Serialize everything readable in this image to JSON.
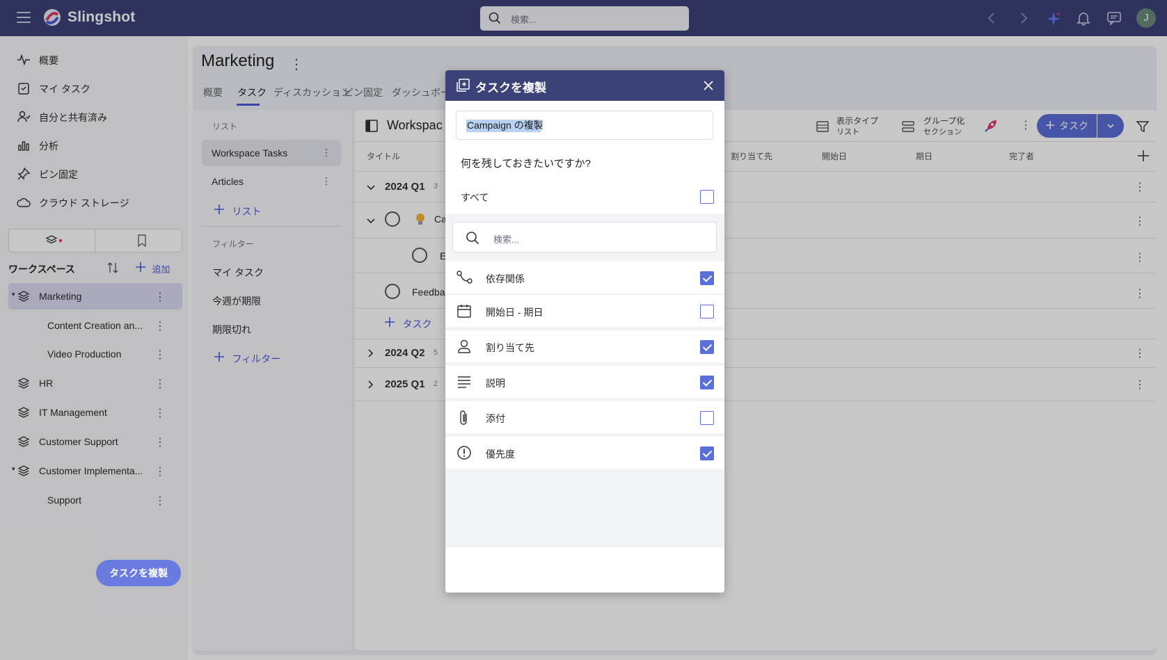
{
  "app": {
    "brand": "Slingshot",
    "search_placeholder": "検索...",
    "avatar_initial": "J"
  },
  "sidebar": {
    "nav": [
      {
        "label": "概要",
        "icon": "activity-icon"
      },
      {
        "label": "マイ タスク",
        "icon": "task-clipboard-icon"
      },
      {
        "label": "自分と共有済み",
        "icon": "shared-user-icon"
      },
      {
        "label": "分析",
        "icon": "bar-chart-icon"
      },
      {
        "label": "ピン固定",
        "icon": "pin-icon"
      },
      {
        "label": "クラウド ストレージ",
        "icon": "cloud-icon"
      }
    ],
    "workspaces_title": "ワークスペース",
    "add_label": "追加",
    "workspaces": [
      {
        "label": "Marketing",
        "selected": true
      },
      {
        "label": "Content Creation an...",
        "child": true
      },
      {
        "label": "Video Production",
        "child": true
      },
      {
        "label": "HR"
      },
      {
        "label": "IT Management"
      },
      {
        "label": "Customer Support"
      },
      {
        "label": "Customer Implementa..."
      },
      {
        "label": "Support",
        "child": true
      }
    ]
  },
  "project": {
    "title": "Marketing",
    "tabs": [
      "概要",
      "タスク",
      "ディスカッション",
      "ピン固定",
      "ダッシュボード"
    ],
    "active_tab": "タスク"
  },
  "lists": {
    "section_label": "リスト",
    "items": [
      "Workspace Tasks",
      "Articles"
    ],
    "add_list": "リスト",
    "filter_label": "フィルター",
    "filters": [
      "マイ タスク",
      "今週が期限",
      "期限切れ"
    ],
    "add_filter": "フィルター"
  },
  "tasks": {
    "title": "Workspac",
    "view_type": "表示タイプ",
    "view_type_value": "リスト",
    "group_by": "グループ化",
    "group_by_value": "セクション",
    "add_task_btn": "タスク",
    "columns": [
      "タイトル",
      "割り当て先",
      "開始日",
      "期日",
      "完了者"
    ],
    "groups": [
      {
        "label": "2024 Q1",
        "count": "3"
      },
      {
        "label": "2024 Q2",
        "count": "5"
      },
      {
        "label": "2025 Q1",
        "count": "2"
      }
    ],
    "rows": [
      "Ca",
      "E",
      "Feedba"
    ],
    "add_task_inline": "タスク"
  },
  "dialog": {
    "title": "タスクを複製",
    "name_value": "Campaign の複製",
    "question": "何を残しておきたいですか?",
    "all_label": "すべて",
    "all_checked": false,
    "search_placeholder": "検索...",
    "options": [
      {
        "label": "依存関係",
        "icon": "dependency-icon",
        "checked": true
      },
      {
        "label": "開始日 - 期日",
        "icon": "calendar-icon",
        "checked": false
      },
      {
        "label": "割り当て先",
        "icon": "person-icon",
        "checked": true
      },
      {
        "label": "説明",
        "icon": "lines-icon",
        "checked": true
      },
      {
        "label": "添付",
        "icon": "paperclip-icon",
        "checked": false
      },
      {
        "label": "優先度",
        "icon": "exclamation-circle-icon",
        "checked": true
      }
    ],
    "submit": "タスクを複製"
  },
  "colors": {
    "header": "#3a4277",
    "accent": "#5b6ed9",
    "checkbox": "#5b6ed9"
  }
}
